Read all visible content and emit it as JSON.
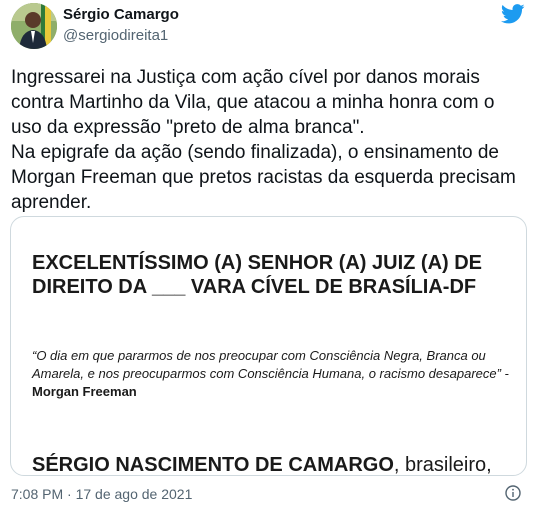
{
  "author": {
    "name": "Sérgio Camargo",
    "handle": "@sergiodireita1"
  },
  "tweet": {
    "paragraph1": "Ingressarei na Justiça com ação cível por danos morais contra Martinho da Vila, que atacou a minha honra com o uso da expressão \"preto de alma branca\".",
    "paragraph2": "Na epigrafe da ação (sendo finalizada), o ensinamento de Morgan Freeman que pretos racistas da esquerda precisam aprender."
  },
  "document": {
    "heading": "EXCELENTÍSSIMO (A) SENHOR (A) JUIZ (A) DE DIREITO DA ___ VARA CÍVEL DE BRASÍLIA-DF",
    "quote": "“O dia em que pararmos de nos preocupar com Consciência Negra, Branca ou Amarela, e nos preocuparmos com Consciência Humana, o racismo desaparece” -",
    "quote_author": "Morgan Freeman",
    "party_name": "SÉRGIO NASCIMENTO DE CAMARGO",
    "party_rest": ", brasileiro,"
  },
  "meta": {
    "timestamp": "7:08 PM · 17 de ago de 2021"
  },
  "icons": {
    "brand": "twitter-bird-icon",
    "info": "info-icon"
  },
  "colors": {
    "twitter_blue": "#1d9bf0",
    "secondary_text": "#536471"
  }
}
